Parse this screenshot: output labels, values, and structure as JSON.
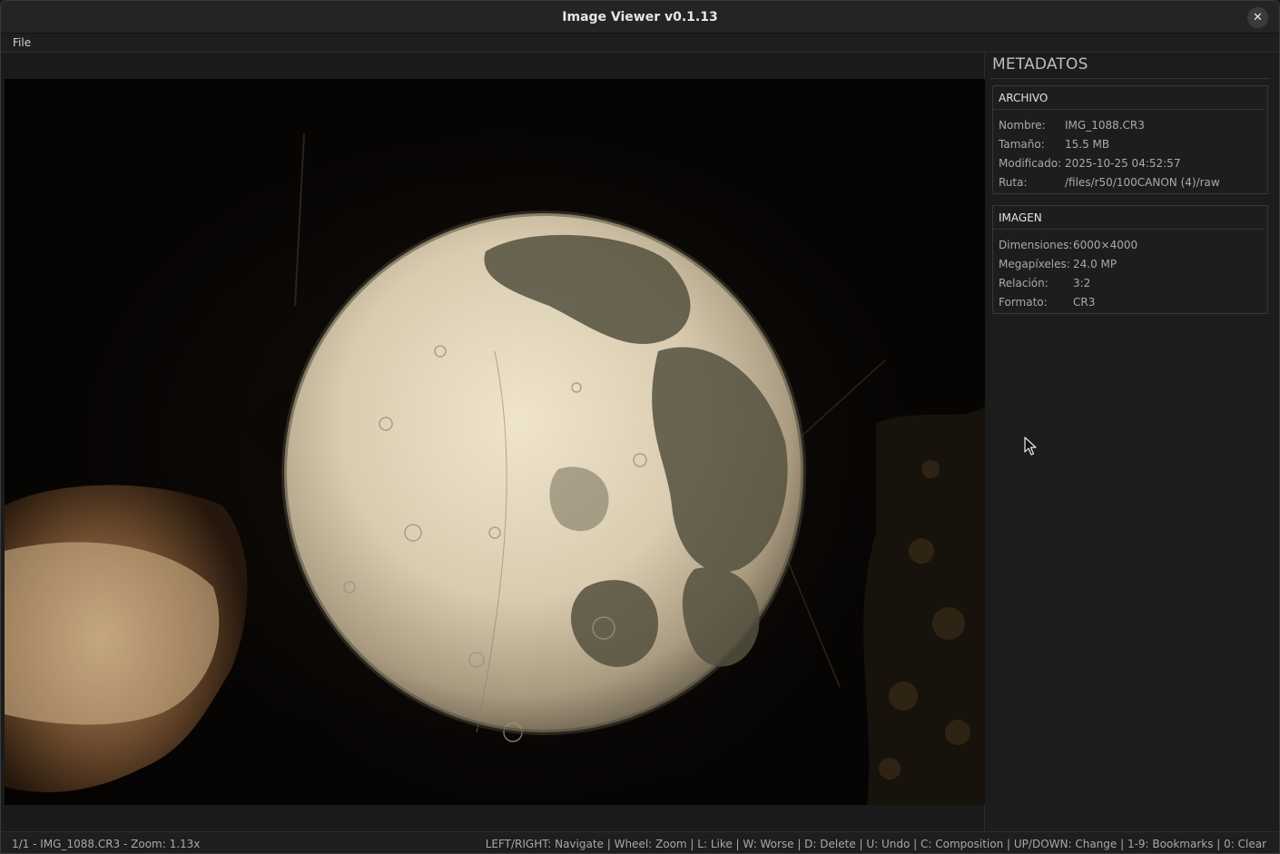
{
  "window": {
    "title": "Image Viewer v0.1.13",
    "close_label": "✕"
  },
  "menubar": {
    "file_label": "File"
  },
  "sidebar": {
    "title": "METADATOS",
    "archivo": {
      "heading": "ARCHIVO",
      "rows": [
        {
          "key": "Nombre:",
          "value": "IMG_1088.CR3"
        },
        {
          "key": "Tamaño:",
          "value": "15.5 MB"
        },
        {
          "key": "Modificado:",
          "value": "2025-10-25 04:52:57"
        },
        {
          "key": "Ruta:",
          "value": "/files/r50/100CANON (4)/raw"
        }
      ]
    },
    "imagen": {
      "heading": "IMAGEN",
      "rows": [
        {
          "key": "Dimensiones:",
          "value": "6000×4000"
        },
        {
          "key": "Megapíxeles:",
          "value": "24.0 MP"
        },
        {
          "key": "Relación:",
          "value": "3:2"
        },
        {
          "key": "Formato:",
          "value": "CR3"
        }
      ]
    }
  },
  "status": {
    "left": "1/1 - IMG_1088.CR3 - Zoom: 1.13x",
    "right": "LEFT/RIGHT: Navigate | Wheel: Zoom | L: Like | W: Worse | D: Delete | U: Undo | C: Composition | UP/DOWN: Change | 1-9: Bookmarks | 0: Clear"
  },
  "colors": {
    "background": "#1b1b1b",
    "titlebar": "#242424",
    "text": "#cfcfcf",
    "moon_light": "#e8dcc4",
    "moon_dark": "#3a3a30"
  },
  "icons": {
    "close": "close-icon",
    "cursor": "mouse-pointer-icon"
  }
}
